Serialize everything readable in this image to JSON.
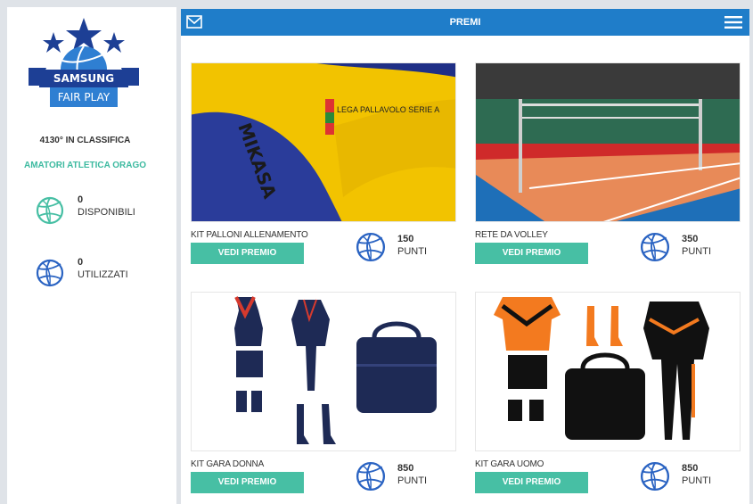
{
  "brand": {
    "line1": "SAMSUNG",
    "line2": "FAIR PLAY",
    "colors": {
      "star": "#1d3f95",
      "badge": "#1f7dc9",
      "ribbon": "#1d3f95"
    }
  },
  "profile": {
    "rank_text": "4130° IN CLASSIFICA",
    "team_name": "AMATORI ATLETICA ORAGO",
    "stats": [
      {
        "value": "0",
        "label": "DISPONIBILI",
        "icon": "volleyball-teal-icon"
      },
      {
        "value": "0",
        "label": "UTILIZZATI",
        "icon": "volleyball-blue-icon"
      }
    ]
  },
  "header": {
    "title": "PREMI",
    "mail_icon": "mail-icon",
    "menu_icon": "hamburger-menu-icon"
  },
  "prizes": [
    {
      "name": "KIT PALLONI ALLENAMENTO",
      "button": "VEDI PREMIO",
      "points": "150",
      "points_label": "PUNTI",
      "image_text_1": "MIKASA",
      "image_text_2": "LEGA PALLAVOLO SERIE A"
    },
    {
      "name": "RETE DA VOLLEY",
      "button": "VEDI PREMIO",
      "points": "350",
      "points_label": "PUNTI"
    },
    {
      "name": "KIT GARA DONNA",
      "button": "VEDI PREMIO",
      "points": "850",
      "points_label": "PUNTI"
    },
    {
      "name": "KIT GARA UOMO",
      "button": "VEDI PREMIO",
      "points": "850",
      "points_label": "PUNTI"
    }
  ],
  "colors": {
    "accent": "#47bfa4",
    "header": "#1f7dc9",
    "ball_blue": "#2a63c2"
  }
}
